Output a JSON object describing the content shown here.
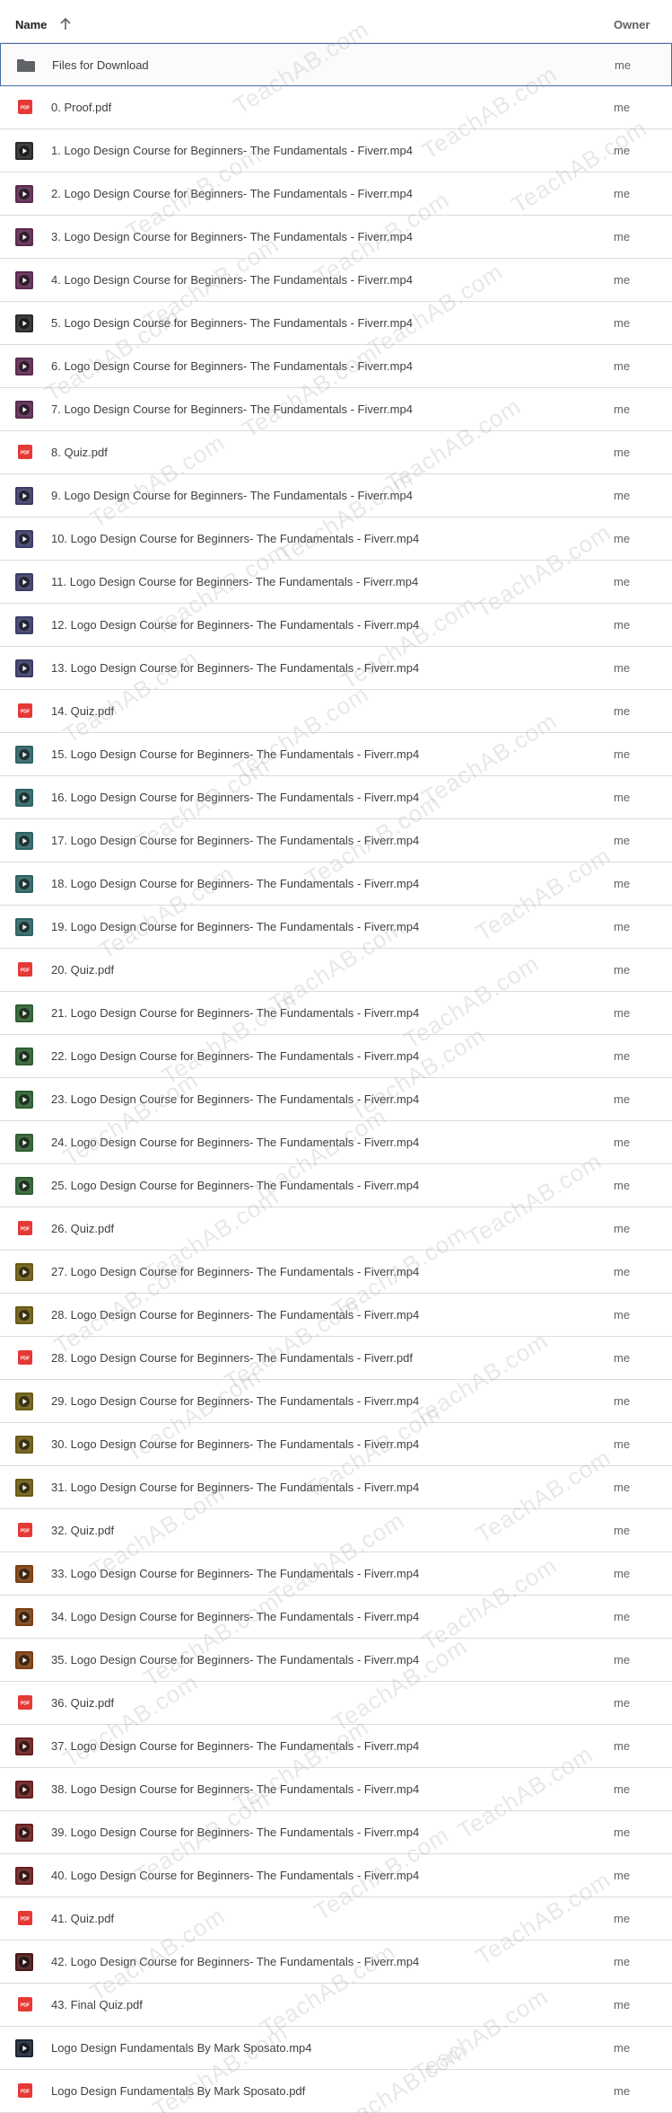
{
  "header": {
    "name_label": "Name",
    "owner_label": "Owner"
  },
  "watermark": "TeachAB.com",
  "colors": {
    "pdf_red": "#e53935",
    "folder_grey": "#5f6368",
    "selected_border": "#4a6fa5"
  },
  "files": [
    {
      "name": "Files for Download",
      "type": "folder",
      "owner": "me",
      "thumb": "#5f6368"
    },
    {
      "name": "0. Proof.pdf",
      "type": "pdf",
      "owner": "me"
    },
    {
      "name": "1. Logo Design Course for Beginners- The Fundamentals - Fiverr.mp4",
      "type": "video",
      "owner": "me",
      "thumb": "#2a2a2a"
    },
    {
      "name": "2. Logo Design Course for Beginners- The Fundamentals - Fiverr.mp4",
      "type": "video",
      "owner": "me",
      "thumb": "#5b2a4e"
    },
    {
      "name": "3. Logo Design Course for Beginners- The Fundamentals - Fiverr.mp4",
      "type": "video",
      "owner": "me",
      "thumb": "#5b2a4e"
    },
    {
      "name": "4. Logo Design Course for Beginners- The Fundamentals - Fiverr.mp4",
      "type": "video",
      "owner": "me",
      "thumb": "#5b2a4e"
    },
    {
      "name": "5. Logo Design Course for Beginners- The Fundamentals - Fiverr.mp4",
      "type": "video",
      "owner": "me",
      "thumb": "#2a2a2a"
    },
    {
      "name": "6. Logo Design Course for Beginners- The Fundamentals - Fiverr.mp4",
      "type": "video",
      "owner": "me",
      "thumb": "#5b2a4e"
    },
    {
      "name": "7. Logo Design Course for Beginners- The Fundamentals - Fiverr.mp4",
      "type": "video",
      "owner": "me",
      "thumb": "#5b2a4e"
    },
    {
      "name": "8. Quiz.pdf",
      "type": "pdf",
      "owner": "me"
    },
    {
      "name": "9. Logo Design Course for Beginners- The Fundamentals - Fiverr.mp4",
      "type": "video",
      "owner": "me",
      "thumb": "#3b3d66"
    },
    {
      "name": "10. Logo Design Course for Beginners- The Fundamentals - Fiverr.mp4",
      "type": "video",
      "owner": "me",
      "thumb": "#3b3d66"
    },
    {
      "name": "11. Logo Design Course for Beginners- The Fundamentals - Fiverr.mp4",
      "type": "video",
      "owner": "me",
      "thumb": "#3b3d66"
    },
    {
      "name": "12. Logo Design Course for Beginners- The Fundamentals - Fiverr.mp4",
      "type": "video",
      "owner": "me",
      "thumb": "#3b3d66"
    },
    {
      "name": "13. Logo Design Course for Beginners- The Fundamentals - Fiverr.mp4",
      "type": "video",
      "owner": "me",
      "thumb": "#3b3d66"
    },
    {
      "name": "14. Quiz.pdf",
      "type": "pdf",
      "owner": "me"
    },
    {
      "name": "15. Logo Design Course for Beginners- The Fundamentals - Fiverr.mp4",
      "type": "video",
      "owner": "me",
      "thumb": "#2f6364"
    },
    {
      "name": "16. Logo Design Course for Beginners- The Fundamentals - Fiverr.mp4",
      "type": "video",
      "owner": "me",
      "thumb": "#2f6364"
    },
    {
      "name": "17. Logo Design Course for Beginners- The Fundamentals - Fiverr.mp4",
      "type": "video",
      "owner": "me",
      "thumb": "#2f6364"
    },
    {
      "name": "18. Logo Design Course for Beginners- The Fundamentals - Fiverr.mp4",
      "type": "video",
      "owner": "me",
      "thumb": "#2f6364"
    },
    {
      "name": "19. Logo Design Course for Beginners- The Fundamentals - Fiverr.mp4",
      "type": "video",
      "owner": "me",
      "thumb": "#2f6364"
    },
    {
      "name": "20. Quiz.pdf",
      "type": "pdf",
      "owner": "me"
    },
    {
      "name": "21. Logo Design Course for Beginners- The Fundamentals - Fiverr.mp4",
      "type": "video",
      "owner": "me",
      "thumb": "#2e5e30"
    },
    {
      "name": "22. Logo Design Course for Beginners- The Fundamentals - Fiverr.mp4",
      "type": "video",
      "owner": "me",
      "thumb": "#2e5e30"
    },
    {
      "name": "23. Logo Design Course for Beginners- The Fundamentals - Fiverr.mp4",
      "type": "video",
      "owner": "me",
      "thumb": "#2e5e30"
    },
    {
      "name": "24. Logo Design Course for Beginners- The Fundamentals - Fiverr.mp4",
      "type": "video",
      "owner": "me",
      "thumb": "#2e5e30"
    },
    {
      "name": "25. Logo Design Course for Beginners- The Fundamentals - Fiverr.mp4",
      "type": "video",
      "owner": "me",
      "thumb": "#2e5e30"
    },
    {
      "name": "26. Quiz.pdf",
      "type": "pdf",
      "owner": "me"
    },
    {
      "name": "27. Logo Design Course for Beginners- The Fundamentals - Fiverr.mp4",
      "type": "video",
      "owner": "me",
      "thumb": "#6b5a12"
    },
    {
      "name": "28. Logo Design Course for Beginners- The Fundamentals - Fiverr.mp4",
      "type": "video",
      "owner": "me",
      "thumb": "#6b5a12"
    },
    {
      "name": "28. Logo Design Course for Beginners- The Fundamentals - Fiverr.pdf",
      "type": "pdf",
      "owner": "me"
    },
    {
      "name": "29. Logo Design Course for Beginners- The Fundamentals - Fiverr.mp4",
      "type": "video",
      "owner": "me",
      "thumb": "#6b5a12"
    },
    {
      "name": "30. Logo Design Course for Beginners- The Fundamentals - Fiverr.mp4",
      "type": "video",
      "owner": "me",
      "thumb": "#6b5a12"
    },
    {
      "name": "31. Logo Design Course for Beginners- The Fundamentals - Fiverr.mp4",
      "type": "video",
      "owner": "me",
      "thumb": "#6b5a12"
    },
    {
      "name": "32. Quiz.pdf",
      "type": "pdf",
      "owner": "me"
    },
    {
      "name": "33. Logo Design Course for Beginners- The Fundamentals - Fiverr.mp4",
      "type": "video",
      "owner": "me",
      "thumb": "#7a3f12"
    },
    {
      "name": "34. Logo Design Course for Beginners- The Fundamentals - Fiverr.mp4",
      "type": "video",
      "owner": "me",
      "thumb": "#7a3f12"
    },
    {
      "name": "35. Logo Design Course for Beginners- The Fundamentals - Fiverr.mp4",
      "type": "video",
      "owner": "me",
      "thumb": "#7a3f12"
    },
    {
      "name": "36. Quiz.pdf",
      "type": "pdf",
      "owner": "me"
    },
    {
      "name": "37. Logo Design Course for Beginners- The Fundamentals - Fiverr.mp4",
      "type": "video",
      "owner": "me",
      "thumb": "#6a1f1f"
    },
    {
      "name": "38. Logo Design Course for Beginners- The Fundamentals - Fiverr.mp4",
      "type": "video",
      "owner": "me",
      "thumb": "#6a1f1f"
    },
    {
      "name": "39. Logo Design Course for Beginners- The Fundamentals - Fiverr.mp4",
      "type": "video",
      "owner": "me",
      "thumb": "#6a1f1f"
    },
    {
      "name": "40. Logo Design Course for Beginners- The Fundamentals - Fiverr.mp4",
      "type": "video",
      "owner": "me",
      "thumb": "#6a1f1f"
    },
    {
      "name": "41. Quiz.pdf",
      "type": "pdf",
      "owner": "me"
    },
    {
      "name": "42. Logo Design Course for Beginners- The Fundamentals - Fiverr.mp4",
      "type": "video",
      "owner": "me",
      "thumb": "#4a1818"
    },
    {
      "name": "43. Final Quiz.pdf",
      "type": "pdf",
      "owner": "me"
    },
    {
      "name": "Logo Design Fundamentals By Mark  Sposato.mp4",
      "type": "video",
      "owner": "me",
      "thumb": "#1c2733"
    },
    {
      "name": "Logo Design Fundamentals By Mark  Sposato.pdf",
      "type": "pdf",
      "owner": "me"
    }
  ]
}
